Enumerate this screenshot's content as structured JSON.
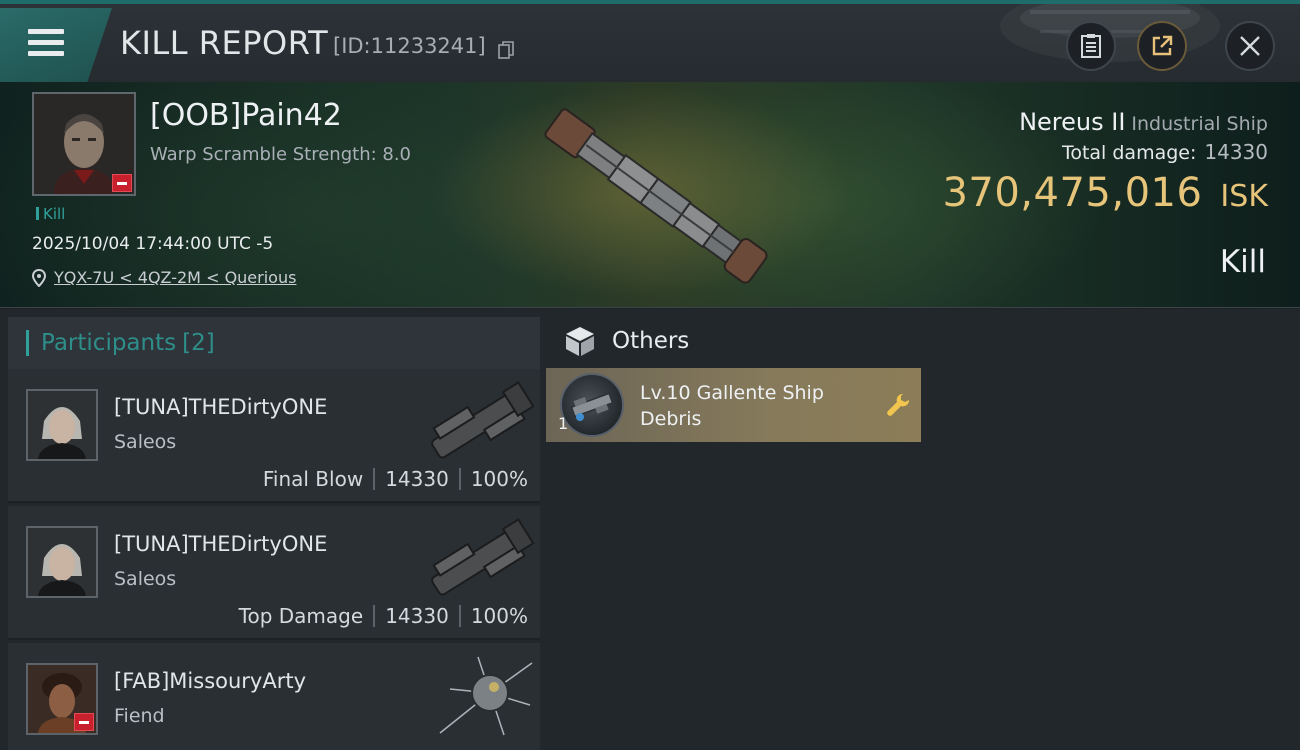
{
  "header": {
    "title": "KILL REPORT",
    "report_id": "[ID:11233241]"
  },
  "victim": {
    "name": "[OOB]Pain42",
    "warp_scramble": "Warp Scramble Strength: 8.0",
    "tag": "Kill",
    "time": "2025/10/04 17:44:00 UTC -5",
    "location": "YQX-7U < 4QZ-2M < Querious"
  },
  "ship": {
    "name": "Nereus II",
    "class": "Industrial Ship",
    "damage_label": "Total damage:",
    "damage_value": "14330",
    "isk_value": "370,475,016",
    "isk_unit": "ISK",
    "result": "Kill"
  },
  "participants": {
    "label": "Participants",
    "count": "[2]",
    "rows": [
      {
        "name": "[TUNA]THEDirtyONE",
        "ship": "Saleos",
        "role": "Final Blow",
        "damage": "14330",
        "percent": "100%"
      },
      {
        "name": "[TUNA]THEDirtyONE",
        "ship": "Saleos",
        "role": "Top Damage",
        "damage": "14330",
        "percent": "100%"
      },
      {
        "name": "[FAB]MissouryArty",
        "ship": "Fiend"
      }
    ]
  },
  "others": {
    "label": "Others",
    "items": [
      {
        "name": "Lv.10 Gallente Ship Debris",
        "qty": "1"
      }
    ]
  },
  "colors": {
    "accent_teal": "#2fa19a",
    "isk_gold": "#e6c47a",
    "danger_red": "#c8202c"
  }
}
